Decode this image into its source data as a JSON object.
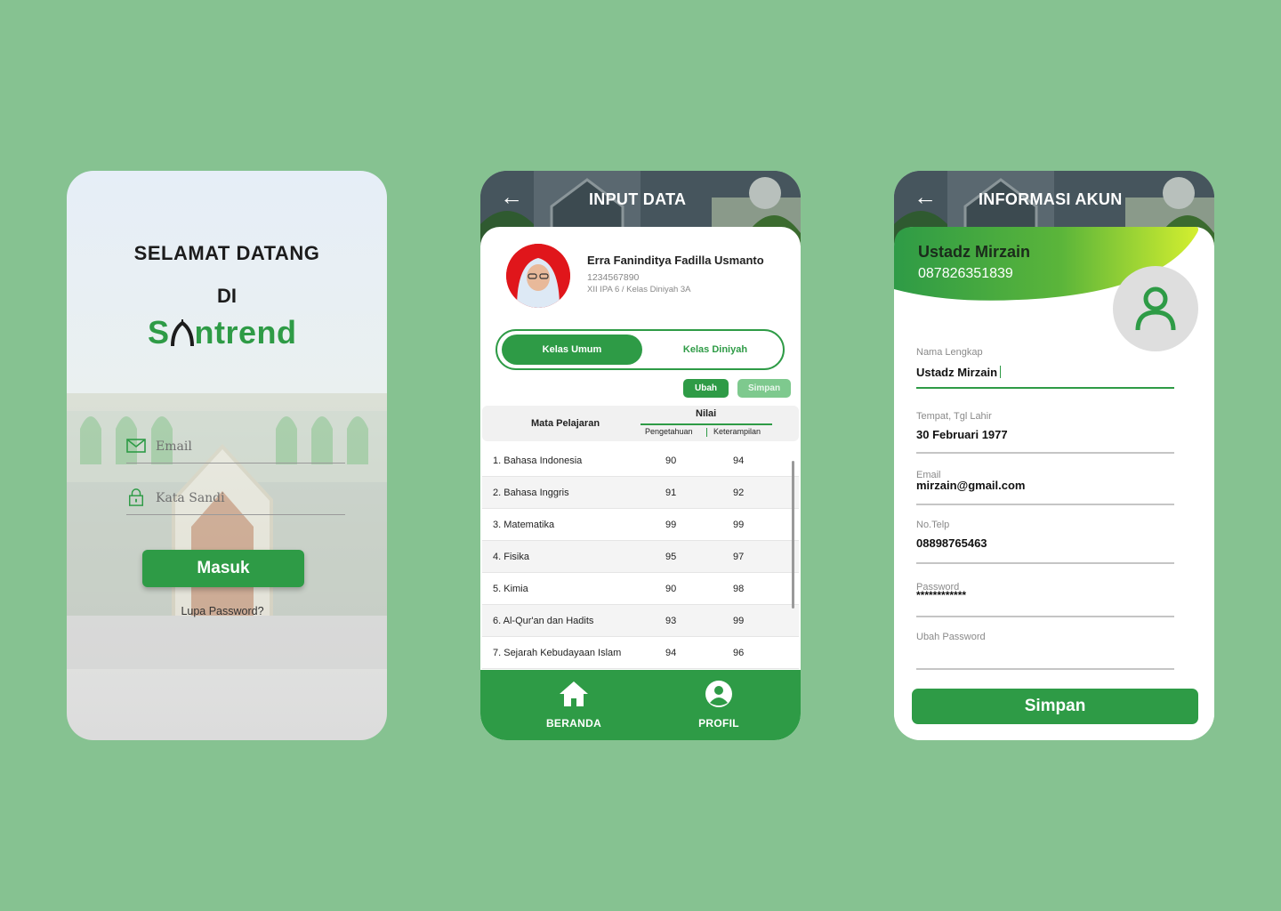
{
  "login": {
    "welcome": "SELAMAT DATANG",
    "di": "DI",
    "brand": {
      "s": "S",
      "rest": "ntrend"
    },
    "email_placeholder": "Email",
    "password_placeholder": "Kata Sandi",
    "login_button": "Masuk",
    "forgot": "Lupa Password?"
  },
  "input_data": {
    "title": "INPUT DATA",
    "student": {
      "name": "Erra Faninditya Fadilla Usmanto",
      "id": "1234567890",
      "class": "XII IPA 6 / Kelas Diniyah 3A"
    },
    "tabs": [
      "Kelas Umum",
      "Kelas Diniyah"
    ],
    "ubah": "Ubah",
    "simpan": "Simpan",
    "table": {
      "col_subject": "Mata Pelajaran",
      "col_nilai": "Nilai",
      "col_pengetahuan": "Pengetahuan",
      "col_keterampilan": "Keterampilan",
      "rows": [
        {
          "subject": "1. Bahasa Indonesia",
          "p": "90",
          "k": "94"
        },
        {
          "subject": "2. Bahasa Inggris",
          "p": "91",
          "k": "92"
        },
        {
          "subject": "3. Matematika",
          "p": "99",
          "k": "99"
        },
        {
          "subject": "4. Fisika",
          "p": "95",
          "k": "97"
        },
        {
          "subject": "5. Kimia",
          "p": "90",
          "k": "98"
        },
        {
          "subject": "6. Al-Qur'an dan Hadits",
          "p": "93",
          "k": "99"
        },
        {
          "subject": "7. Sejarah Kebudayaan Islam",
          "p": "94",
          "k": "96"
        }
      ]
    },
    "nav": {
      "home": "BERANDA",
      "profile": "PROFIL"
    }
  },
  "akun": {
    "title": "INFORMASI AKUN",
    "name": "Ustadz Mirzain",
    "phone": "087826351839",
    "fields": {
      "nama_label": "Nama Lengkap",
      "nama_value": "Ustadz Mirzain",
      "ttl_label": "Tempat, Tgl Lahir",
      "ttl_value": "30 Februari 1977",
      "email_label": "Email",
      "email_value": "mirzain@gmail.com",
      "telp_label": "No.Telp",
      "telp_value": "08898765463",
      "password_label": "Password",
      "password_value": "************",
      "ubah_label": "Ubah Password",
      "ubah_value": ""
    },
    "save_button": "Simpan"
  },
  "colors": {
    "primary": "#2e9b46",
    "background": "#86c291",
    "lime": "#d4ef2f"
  }
}
